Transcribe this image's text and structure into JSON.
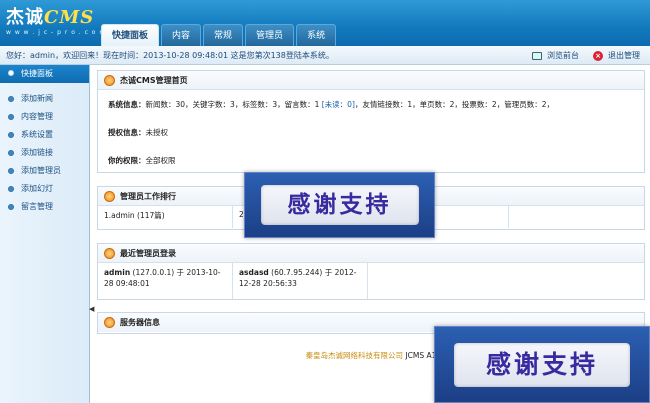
{
  "header": {
    "logo_main": "杰诚",
    "logo_cms": "CMS",
    "logo_sub": "w w w . j c - p r o . c o m",
    "tabs": [
      {
        "label": "快捷面板",
        "active": true
      },
      {
        "label": "内容",
        "active": false
      },
      {
        "label": "常规",
        "active": false
      },
      {
        "label": "管理员",
        "active": false
      },
      {
        "label": "系统",
        "active": false
      }
    ]
  },
  "statusbar": {
    "welcome": "您好：admin，欢迎回来！现在时间：2013-10-28 09:48:01 这是您第次138登陆本系统。",
    "browse_label": "浏览前台",
    "logout_label": "退出管理"
  },
  "sidebar": {
    "header": "快捷面板",
    "items": [
      "添加新闻",
      "内容管理",
      "系统设置",
      "添加链接",
      "添加管理员",
      "添加幻灯",
      "留言管理"
    ]
  },
  "panel_home": {
    "title": "杰诚CMS管理首页",
    "sysinfo_label": "系统信息：",
    "sysinfo_a": "新闻数：30，关键字数：3，标签数：3，留言数：1 ",
    "sysinfo_link": "[未读：0]",
    "sysinfo_b": "，友情链接数：1，单页数：2，投票数：2，管理员数：2，",
    "auth_label": "授权信息：",
    "auth_value": "未授权",
    "perm_label": "你的权限：",
    "perm_value": "全部权限"
  },
  "panel_ranking": {
    "title": "管理员工作排行",
    "cells": [
      "1.admin (117篇)",
      "2",
      "",
      ""
    ]
  },
  "panel_logins": {
    "title": "最近管理员登录",
    "entries": [
      {
        "user": "admin",
        "detail": " (127.0.0.1) 于 2013-10-28 09:48:01"
      },
      {
        "user": "asdasd",
        "detail": " (60.7.95.244) 于 2012-12-28 20:56:33"
      }
    ]
  },
  "panel_server": {
    "title": "服务器信息"
  },
  "footer": {
    "company": "秦皇岛杰诚网络科技有限公司",
    "product": " JCMS A1"
  },
  "overlay": {
    "banner_text": "感谢支持"
  },
  "colors": {
    "header_blue": "#1279bd",
    "link_blue": "#1a5fa8",
    "footer_gold": "#c98c12",
    "banner_text": "#3a2aa0"
  }
}
